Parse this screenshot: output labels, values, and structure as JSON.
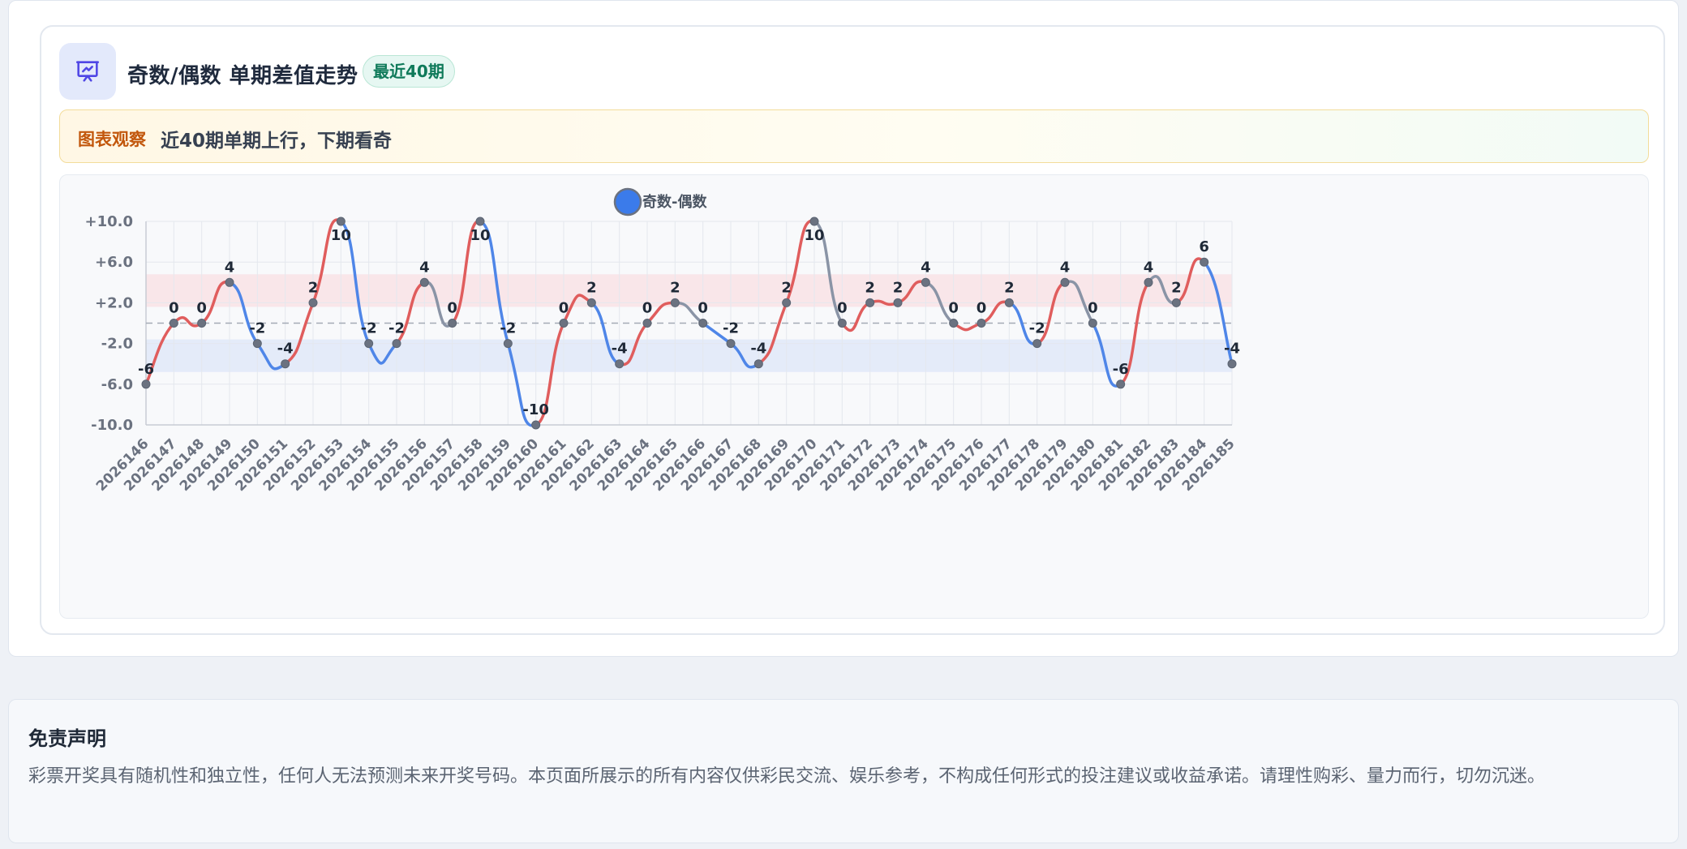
{
  "header": {
    "title": "奇数/偶数 单期差值走势",
    "badge": "最近40期"
  },
  "observation": {
    "tag": "图表观察",
    "text": "近40期单期上行，下期看奇"
  },
  "chart_data": {
    "type": "line",
    "legend": "奇数-偶数",
    "x": [
      "2026146",
      "2026147",
      "2026148",
      "2026149",
      "2026150",
      "2026151",
      "2026152",
      "2026153",
      "2026154",
      "2026155",
      "2026156",
      "2026157",
      "2026158",
      "2026159",
      "2026160",
      "2026161",
      "2026162",
      "2026163",
      "2026164",
      "2026165",
      "2026166",
      "2026167",
      "2026168",
      "2026169",
      "2026170",
      "2026171",
      "2026172",
      "2026173",
      "2026174",
      "2026175",
      "2026176",
      "2026177",
      "2026178",
      "2026179",
      "2026180",
      "2026181",
      "2026182",
      "2026183",
      "2026184",
      "2026185"
    ],
    "values": [
      -6,
      0,
      0,
      4,
      -2,
      -4,
      2,
      10,
      -2,
      -2,
      4,
      0,
      10,
      -2,
      -10,
      0,
      2,
      -4,
      0,
      2,
      0,
      -2,
      -4,
      2,
      10,
      0,
      2,
      2,
      4,
      0,
      0,
      2,
      -2,
      4,
      0,
      -6,
      4,
      2,
      6,
      -4
    ],
    "y_ticks": [
      "+10.0",
      "+6.0",
      "+2.0",
      "-2.0",
      "-6.0",
      "-10.0"
    ],
    "ylim": [
      -10,
      10
    ],
    "bands": [
      {
        "from": 1.6,
        "to": 4.8
      },
      {
        "from": -4.8,
        "to": -1.6
      }
    ],
    "reference_line": 0,
    "colors": {
      "up": "#e05d5d",
      "down": "#4f86e8",
      "flat": "#8a94a6",
      "upper_band": "#f9dfe3",
      "lower_band": "#dde6f8",
      "legend_dot": "#3b7bea"
    },
    "grid": true,
    "legend_position": "top-center"
  },
  "disclaimer": {
    "title": "免责声明",
    "body": "彩票开奖具有随机性和独立性，任何人无法预测未来开奖号码。本页面所展示的所有内容仅供彩民交流、娱乐参考，不构成任何形式的投注建议或收益承诺。请理性购彩、量力而行，切勿沉迷。"
  }
}
